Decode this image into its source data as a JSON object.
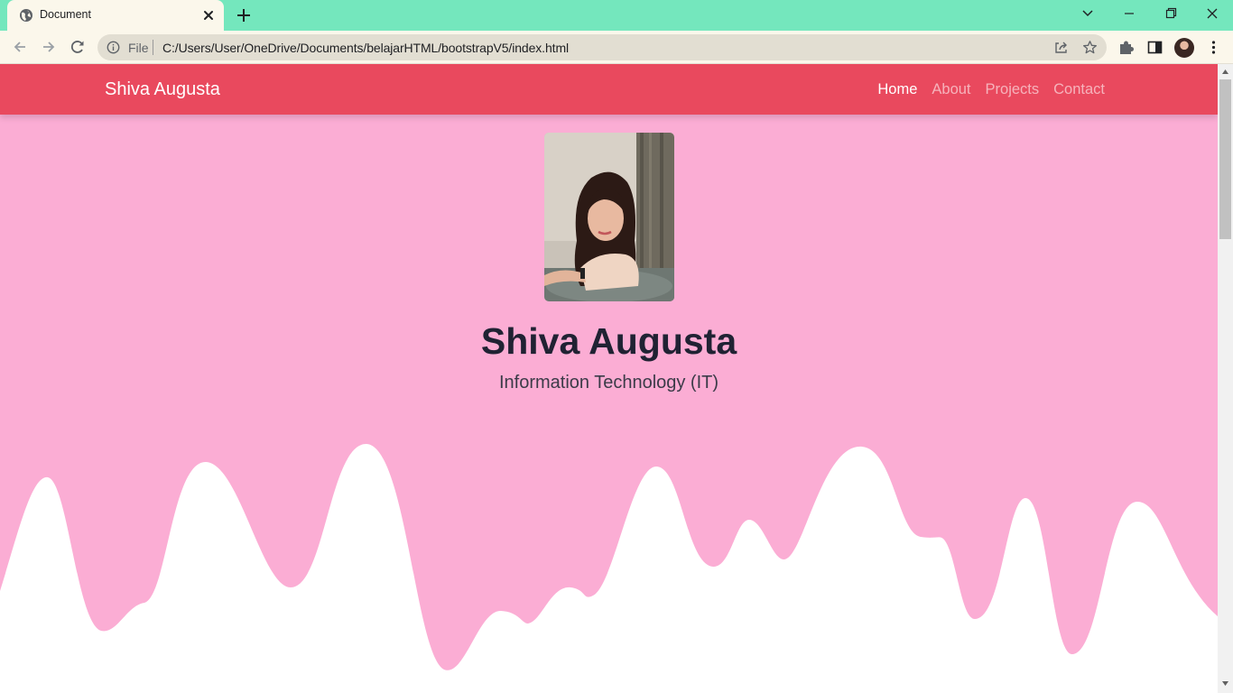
{
  "browser": {
    "tab_title": "Document",
    "omnibox": {
      "scheme_label": "File",
      "url": "C:/Users/User/OneDrive/Documents/belajarHTML/bootstrapV5/index.html"
    }
  },
  "navbar": {
    "brand": "Shiva Augusta",
    "links": [
      {
        "label": "Home",
        "active": true
      },
      {
        "label": "About",
        "active": false
      },
      {
        "label": "Projects",
        "active": false
      },
      {
        "label": "Contact",
        "active": false
      }
    ]
  },
  "hero": {
    "name": "Shiva Augusta",
    "subtitle": "Information Technology (IT)"
  },
  "colors": {
    "tab_strip": "#74e7bd",
    "toolbar": "#fbf7eb",
    "navbar": "#e9495e",
    "hero_background": "#fbadd4",
    "wave": "#ffffff"
  },
  "icons": [
    "globe-icon",
    "close-icon",
    "plus-icon",
    "chevron-down-icon",
    "minimize-icon",
    "restore-icon",
    "window-close-icon",
    "back-icon",
    "forward-icon",
    "reload-icon",
    "info-icon",
    "share-icon",
    "star-icon",
    "puzzle-icon",
    "side-panel-icon",
    "more-vert-icon"
  ]
}
